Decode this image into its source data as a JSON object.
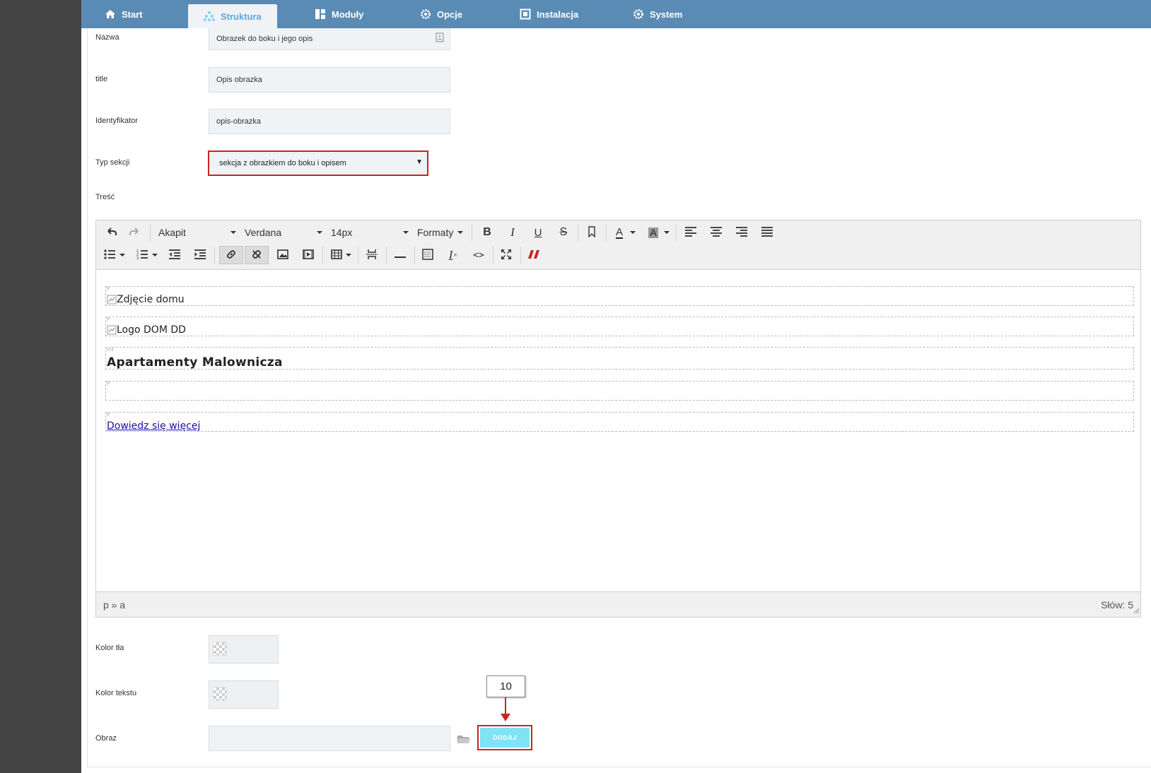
{
  "nav": {
    "tabs": [
      {
        "label": "Start",
        "icon": "home-icon"
      },
      {
        "label": "Struktura",
        "icon": "structure-icon",
        "active": true
      },
      {
        "label": "Moduły",
        "icon": "modules-icon"
      },
      {
        "label": "Opcje",
        "icon": "gear-icon"
      },
      {
        "label": "Instalacja",
        "icon": "install-icon"
      },
      {
        "label": "System",
        "icon": "gear-icon"
      }
    ]
  },
  "form": {
    "nazwa": {
      "label": "Nazwa",
      "value": "Obrazek do boku i jego opis"
    },
    "title": {
      "label": "title",
      "value": "Opis obrazka"
    },
    "identyfikator": {
      "label": "Identyfikator",
      "value": "opis-obrazka"
    },
    "typ_sekcji": {
      "label": "Typ sekcji",
      "value": "sekcja z obrazkiem do boku i opisem"
    },
    "tresc": {
      "label": "Treść"
    },
    "kolor_tla": {
      "label": "Kolor tła"
    },
    "kolor_tekstu": {
      "label": "Kolor tekstu"
    },
    "obraz": {
      "label": "Obraz",
      "value": ""
    }
  },
  "editor": {
    "toolbar": {
      "format_block": "Akapit",
      "font_family": "Verdana",
      "font_size": "14px",
      "formats": "Formaty",
      "bold_glyph": "B",
      "italic_glyph": "I",
      "underline_glyph": "U",
      "strike_glyph": "S",
      "text_color_glyph": "A",
      "bg_color_glyph": "A",
      "clear_format_glyph": "I",
      "code_glyph": "<>"
    },
    "content": {
      "img1_alt": "Zdjęcie domu",
      "img2_alt": "Logo DOM DD",
      "heading": "Apartamenty Malownicza",
      "link": "Dowiedz się więcej",
      "tag_p": "P",
      "tag_h3": "H3"
    },
    "statusbar": {
      "path": "p » a",
      "wordcount": "Słów: 5"
    }
  },
  "actions": {
    "dodaj_label": "DODAJ"
  },
  "annotation": {
    "callout_number": "10"
  },
  "colors": {
    "nav_bg": "#5a8bb5",
    "highlight_border": "#cc2222",
    "dodaj_bg": "#7fe3f5",
    "sidebar_bg": "#444444"
  }
}
